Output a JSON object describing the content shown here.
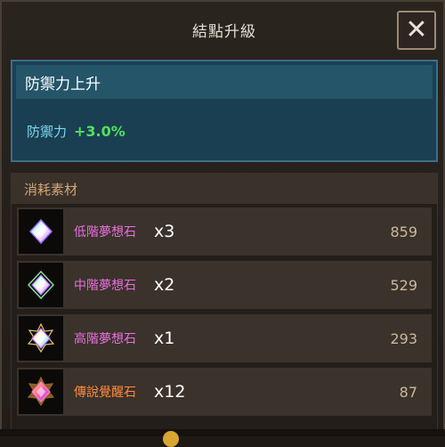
{
  "header": {
    "title": "結點升級",
    "close_glyph": "✕"
  },
  "stat": {
    "title": "防禦力上升",
    "name": "防禦力",
    "value": "+3.0%"
  },
  "materials": {
    "title": "消耗素材",
    "items": [
      {
        "name": "低階夢想石",
        "qty": "x3",
        "owned": "859",
        "name_color": "#e76fe0",
        "icon": "low-dream-stone-icon"
      },
      {
        "name": "中階夢想石",
        "qty": "x2",
        "owned": "529",
        "name_color": "#e76fe0",
        "icon": "mid-dream-stone-icon"
      },
      {
        "name": "高階夢想石",
        "qty": "x1",
        "owned": "293",
        "name_color": "#e76fe0",
        "icon": "high-dream-stone-icon"
      },
      {
        "name": "傳說覺醒石",
        "qty": "x12",
        "owned": "87",
        "name_color": "#ff8a3d",
        "icon": "legend-awakening-stone-icon"
      }
    ]
  }
}
